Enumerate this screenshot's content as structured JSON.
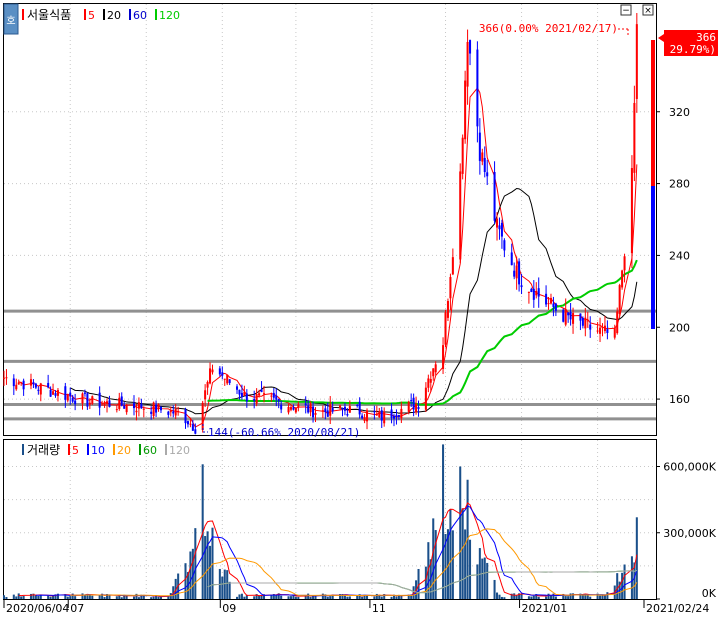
{
  "header": {
    "stock_name": "서울식품",
    "ma_legend": [
      {
        "label": "5",
        "color": "#ff0000"
      },
      {
        "label": "20",
        "color": "#000000"
      },
      {
        "label": "60",
        "color": "#0000cc"
      },
      {
        "label": "120",
        "color": "#00cc00"
      }
    ]
  },
  "volume_header": {
    "title": "거래량",
    "ma_legend": [
      {
        "label": "5",
        "color": "#ff0000"
      },
      {
        "label": "10",
        "color": "#0000ff"
      },
      {
        "label": "20",
        "color": "#ff9900"
      },
      {
        "label": "60",
        "color": "#009900"
      },
      {
        "label": "120",
        "color": "#aaaaaa"
      }
    ]
  },
  "annotations": {
    "high": "366(0.00% 2021/02/17)",
    "low": "144(-60.66% 2020/08/21)",
    "last_price": "366",
    "last_change": "( 29.79%)"
  },
  "colors": {
    "up": "#ff0000",
    "down": "#0000ff",
    "grid": "#c8c8c8",
    "support_line": "#909090",
    "volume_bar": "#1a4f8a",
    "volume_up_bar": "#1a6fa0"
  },
  "chart_data": [
    {
      "type": "candlestick",
      "title": "서울식품",
      "ylim": [
        140,
        380
      ],
      "yticks": [
        160,
        200,
        240,
        280,
        320
      ],
      "x_labels": [
        "2020/06/04",
        "07",
        "09",
        "11",
        "2021/01",
        "2021/02/24"
      ],
      "horizontal_lines": [
        209,
        181,
        157,
        149
      ],
      "series": [
        {
          "name": "price",
          "points": [
            [
              "2020/06/04",
              172
            ],
            [
              "2020/06/20",
              166
            ],
            [
              "2020/07/10",
              158
            ],
            [
              "2020/07/30",
              156
            ],
            [
              "2020/08/15",
              152
            ],
            [
              "2020/08/21",
              144
            ],
            [
              "2020/08/28",
              178
            ],
            [
              "2020/09/10",
              162
            ],
            [
              "2020/09/25",
              158
            ],
            [
              "2020/10/10",
              153
            ],
            [
              "2020/10/25",
              154
            ],
            [
              "2020/11/05",
              150
            ],
            [
              "2020/11/20",
              158
            ],
            [
              "2020/11/30",
              192
            ],
            [
              "2020/12/07",
              285
            ],
            [
              "2020/12/10",
              366
            ],
            [
              "2020/12/15",
              300
            ],
            [
              "2020/12/22",
              255
            ],
            [
              "2020/12/30",
              230
            ],
            [
              "2021/01/10",
              215
            ],
            [
              "2021/01/20",
              205
            ],
            [
              "2021/01/28",
              200
            ],
            [
              "2021/02/08",
              195
            ],
            [
              "2021/02/15",
              282
            ],
            [
              "2021/02/17",
              366
            ]
          ]
        },
        {
          "name": "5",
          "color": "#ff0000"
        },
        {
          "name": "20",
          "color": "#000000"
        },
        {
          "name": "60",
          "color": "#0000cc"
        },
        {
          "name": "120",
          "color": "#00cc00"
        }
      ]
    },
    {
      "type": "bar",
      "title": "거래량",
      "ylim": [
        0,
        720000
      ],
      "yticks": [
        "0K",
        "300,000K",
        "600,000K"
      ],
      "series": [
        {
          "name": "volume",
          "peaks": [
            [
              "2020/08/24",
              610000
            ],
            [
              "2020/11/30",
              700000
            ],
            [
              "2020/12/07",
              600000
            ],
            [
              "2020/12/10",
              540000
            ],
            [
              "2021/02/17",
              370000
            ]
          ]
        },
        {
          "name": "5",
          "color": "#ff0000"
        },
        {
          "name": "10",
          "color": "#0000ff"
        },
        {
          "name": "20",
          "color": "#ff9900"
        },
        {
          "name": "60",
          "color": "#009900"
        },
        {
          "name": "120",
          "color": "#aaaaaa"
        }
      ]
    }
  ]
}
